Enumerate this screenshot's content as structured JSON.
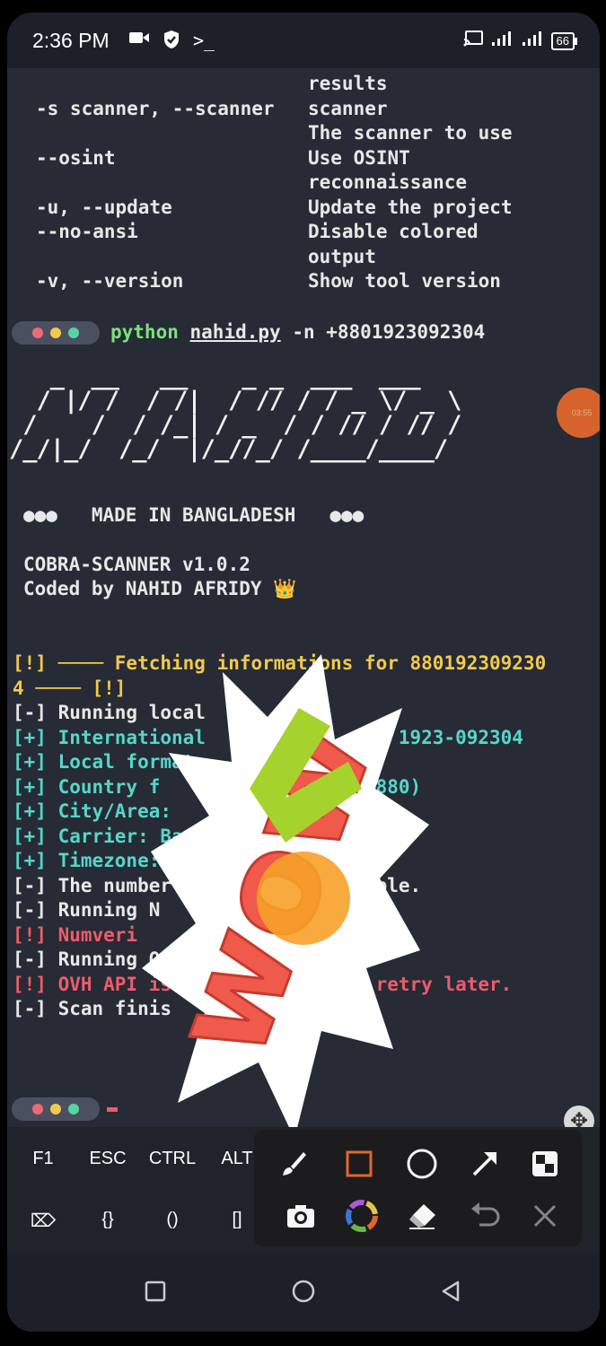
{
  "status_bar": {
    "time": "2:36 PM",
    "left_icons": [
      "video-camera-icon",
      "shield-check-icon",
      "terminal-prompt-icon"
    ],
    "right_icons": [
      "cast-icon",
      "signal-icon",
      "signal-icon"
    ],
    "battery": "66"
  },
  "help_rows": [
    {
      "opt": "",
      "desc": "results"
    },
    {
      "opt": "-s scanner, --scanner",
      "desc": "scanner"
    },
    {
      "opt": "",
      "desc": "The scanner to use"
    },
    {
      "opt": "--osint",
      "desc": "Use OSINT"
    },
    {
      "opt": "",
      "desc": "reconnaissance"
    },
    {
      "opt": "-u, --update",
      "desc": "Update the project"
    },
    {
      "opt": "--no-ansi",
      "desc": "Disable colored"
    },
    {
      "opt": "",
      "desc": "output"
    },
    {
      "opt": "-v, --version",
      "desc": "Show tool version"
    }
  ],
  "prompt_colors": [
    "#ef6b73",
    "#f2c94c",
    "#56d6a0"
  ],
  "command": {
    "program": "python",
    "file": "nahid.py",
    "args": "-n +8801923092304"
  },
  "banner": {
    "ascii_art": "   _  __   __    _ _  ___  ___ \n  / |/ /  / /|  / // / / _ \\/ _ \\\n /    /  / /_| / _  / / // / // /\n/_/|_/  /_/  |/_//_/ /____/____/ ",
    "made_in": "●●●   MADE IN BANGLADESH   ●●●",
    "version": "COBRA-SCANNER v1.0.2",
    "author": "Coded by NAHID AFRIDY 👑"
  },
  "output_lines": [
    {
      "text": "[!] ──── Fetching informations for 880192309230",
      "color": "yellow"
    },
    {
      "text": "4 ──── [!]",
      "color": "yellow"
    },
    {
      "text": "[-] Running local",
      "color": "white"
    },
    {
      "text": "[+] International                 1923-092304",
      "color": "cyan"
    },
    {
      "text": "[+] Local format",
      "color": "cyan"
    },
    {
      "text": "[+] Country f                  +880)",
      "color": "cyan"
    },
    {
      "text": "[+] City/Area:",
      "color": "cyan"
    },
    {
      "text": "[+] Carrier: Ba",
      "color": "cyan"
    },
    {
      "text": "[+] Timezone: A",
      "color": "cyan"
    },
    {
      "text": "[-] The number                sible.",
      "color": "white"
    },
    {
      "text": "[-] Running N                 ...",
      "color": "white"
    },
    {
      "text": "[!] Numveri                   able",
      "color": "red"
    },
    {
      "text": "[-] Running O",
      "color": "white"
    },
    {
      "text": "[!] OVH API is                e retry later.",
      "color": "red"
    },
    {
      "text": "[-] Scan finis",
      "color": "white"
    }
  ],
  "floating_bubble_text": "03:55",
  "sticker_text": "wow",
  "extra_keys": {
    "row1": [
      "F1",
      "ESC",
      "CTRL",
      "ALT"
    ],
    "row2": [
      "⌦",
      "{}",
      "()",
      "[]"
    ]
  },
  "draw_tools": {
    "row1": [
      "brush-icon",
      "rectangle-icon",
      "circle-icon",
      "arrow-icon",
      "mosaic-icon"
    ],
    "row2": [
      "camera-icon",
      "color-wheel-icon",
      "eraser-icon",
      "undo-icon",
      "close-icon"
    ]
  },
  "nav": [
    "recents-square-icon",
    "home-circle-icon",
    "back-triangle-icon"
  ]
}
